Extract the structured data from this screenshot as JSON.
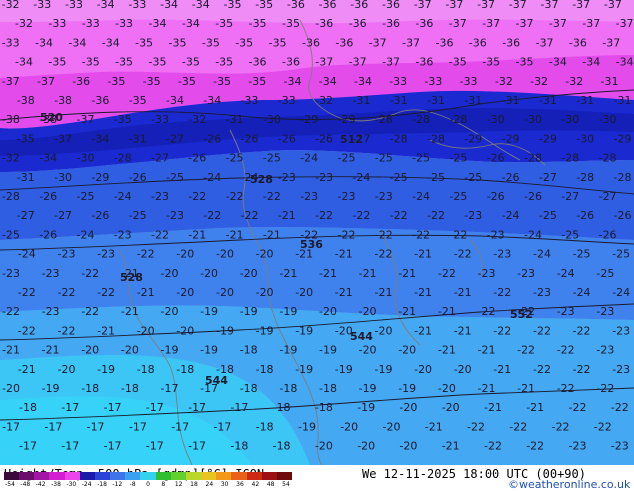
{
  "footer": {
    "title": "Height/Temp. 500 hPa [gdmp][°C] ICON",
    "date": "We 12-11-2025 18:00 UTC (00+90)",
    "credit": "©weatheronline.co.uk"
  },
  "legend": {
    "ticks": [
      "-54",
      "-48",
      "-42",
      "-38",
      "-30",
      "-24",
      "-18",
      "-12",
      "-8",
      "0",
      "8",
      "12",
      "18",
      "24",
      "30",
      "36",
      "42",
      "48",
      "54"
    ],
    "colors": [
      "#3a0a3a",
      "#6b0f6b",
      "#a316a3",
      "#d11fd1",
      "#ee44ee",
      "#1c1ca8",
      "#2a45d6",
      "#3f74e8",
      "#3aa0f0",
      "#32d2f0",
      "#2fbf2f",
      "#62d12e",
      "#b9d92a",
      "#e8c420",
      "#f19a1a",
      "#e8621a",
      "#cc2a12",
      "#9e1010",
      "#6e0a0a"
    ]
  },
  "colors": {
    "magenta_band": "#e040e8",
    "magenta_pale": "#f07af5",
    "navy_band": "#1a2acc",
    "blue_band": "#2f5ee0",
    "mid_blue": "#3f80ee",
    "light_blue": "#43a6f2",
    "cyan": "#38c8f6",
    "contour_color": "#1a1a2e",
    "coast_color": "#808080"
  },
  "map_labels": [
    "-32",
    "-33",
    "-33",
    "-34",
    "-33",
    "-34",
    "-34",
    "-35",
    "-35",
    "-36",
    "-36",
    "-36",
    "-36",
    "-37",
    "-37",
    "-37",
    "-37",
    "-37",
    "-37",
    "-37",
    "-32",
    "-33",
    "-33",
    "-33",
    "-34",
    "-34",
    "-35",
    "-35",
    "-35",
    "-36",
    "-36",
    "-36",
    "-36",
    "-37",
    "-37",
    "-37",
    "-37",
    "-37",
    "-37",
    "-33",
    "-34",
    "-34",
    "-34",
    "-35",
    "-35",
    "-35",
    "-35",
    "-35",
    "-36",
    "-36",
    "-37",
    "-37",
    "-36",
    "-36",
    "-36",
    "-37",
    "-36",
    "-37",
    "-34",
    "-35",
    "-35",
    "-35",
    "-35",
    "-35",
    "-35",
    "-36",
    "-36",
    "-37",
    "-37",
    "-37",
    "-36",
    "-35",
    "-35",
    "-35",
    "-34",
    "-34",
    "-34",
    "-37",
    "-37",
    "-36",
    "-35",
    "-35",
    "-35",
    "-35",
    "-35",
    "-34",
    "-34",
    "-34",
    "-33",
    "-33",
    "-33",
    "-32",
    "-32",
    "-32",
    "-31",
    "-38",
    "-38",
    "-36",
    "-35",
    "-34",
    "-34",
    "-33",
    "-33",
    "-32",
    "-31",
    "-31",
    "-31",
    "-31",
    "-31",
    "-31",
    "-31",
    "-31",
    "-38",
    "-38",
    "-37",
    "-35",
    "-33",
    "-32",
    "-31",
    "-30",
    "-29",
    "-29",
    "-28",
    "-28",
    "-28",
    "-30",
    "-30",
    "-30",
    "-30",
    "-35",
    "-37",
    "-34",
    "-31",
    "-27",
    "-26",
    "-26",
    "-26",
    "-26",
    "-27",
    "-28",
    "-28",
    "-29",
    "-29",
    "-29",
    "-30",
    "-29",
    "-32",
    "-34",
    "-30",
    "-28",
    "-27",
    "-26",
    "-25",
    "-25",
    "-24",
    "-25",
    "-25",
    "-25",
    "-25",
    "-26",
    "-28",
    "-28",
    "-28",
    "-31",
    "-30",
    "-29",
    "-26",
    "-25",
    "-24",
    "-24",
    "-23",
    "-23",
    "-24",
    "-25",
    "-25",
    "-25",
    "-26",
    "-27",
    "-28",
    "-28",
    "-28",
    "-26",
    "-25",
    "-24",
    "-23",
    "-22",
    "-22",
    "-22",
    "-23",
    "-23",
    "-23",
    "-24",
    "-25",
    "-26",
    "-26",
    "-27",
    "-27",
    "-27",
    "-27",
    "-26",
    "-25",
    "-23",
    "-22",
    "-22",
    "-21",
    "-22",
    "-22",
    "-22",
    "-22",
    "-23",
    "-24",
    "-25",
    "-26",
    "-26",
    "-25",
    "-26",
    "-24",
    "-23",
    "-22",
    "-21",
    "-21",
    "-21",
    "-22",
    "-22",
    "-22",
    "-22",
    "-22",
    "-23",
    "-24",
    "-25",
    "-26",
    "-24",
    "-23",
    "-23",
    "-22",
    "-20",
    "-20",
    "-20",
    "-21",
    "-21",
    "-22",
    "-21",
    "-22",
    "-23",
    "-24",
    "-25",
    "-25",
    "-23",
    "-23",
    "-22",
    "-21",
    "-20",
    "-20",
    "-20",
    "-21",
    "-21",
    "-21",
    "-21",
    "-22",
    "-23",
    "-23",
    "-24",
    "-25",
    "-22",
    "-22",
    "-22",
    "-21",
    "-20",
    "-20",
    "-20",
    "-20",
    "-21",
    "-21",
    "-21",
    "-21",
    "-22",
    "-23",
    "-24",
    "-24",
    "-22",
    "-23",
    "-22",
    "-21",
    "-20",
    "-19",
    "-19",
    "-19",
    "-20",
    "-20",
    "-21",
    "-21",
    "-22",
    "-22",
    "-23",
    "-23",
    "-22",
    "-22",
    "-21",
    "-20",
    "-20",
    "-19",
    "-19",
    "-19",
    "-20",
    "-20",
    "-21",
    "-21",
    "-22",
    "-22",
    "-22",
    "-23",
    "-21",
    "-21",
    "-20",
    "-20",
    "-19",
    "-19",
    "-18",
    "-19",
    "-19",
    "-20",
    "-20",
    "-21",
    "-21",
    "-22",
    "-22",
    "-23",
    "-21",
    "-20",
    "-19",
    "-18",
    "-18",
    "-18",
    "-18",
    "-19",
    "-19",
    "-19",
    "-20",
    "-20",
    "-21",
    "-22",
    "-22",
    "-23",
    "-20",
    "-19",
    "-18",
    "-18",
    "-17",
    "-17",
    "-18",
    "-18",
    "-18",
    "-19",
    "-19",
    "-20",
    "-21",
    "-21",
    "-22",
    "-22",
    "-18",
    "-17",
    "-17",
    "-17",
    "-17",
    "-17",
    "-18",
    "-18",
    "-19",
    "-20",
    "-20",
    "-21",
    "-21",
    "-22",
    "-22",
    "-17",
    "-17",
    "-17",
    "-17",
    "-17",
    "-17",
    "-18",
    "-19",
    "-20",
    "-20",
    "-21",
    "-22",
    "-22",
    "-22",
    "-22",
    "-17",
    "-17",
    "-17",
    "-17",
    "-17",
    "-18",
    "-18",
    "-20",
    "-20",
    "-20",
    "-21",
    "-22",
    "-22",
    "-23",
    "-23"
  ],
  "height_labels": [
    "520",
    "512",
    "528",
    "528",
    "536",
    "544",
    "544",
    "552"
  ]
}
